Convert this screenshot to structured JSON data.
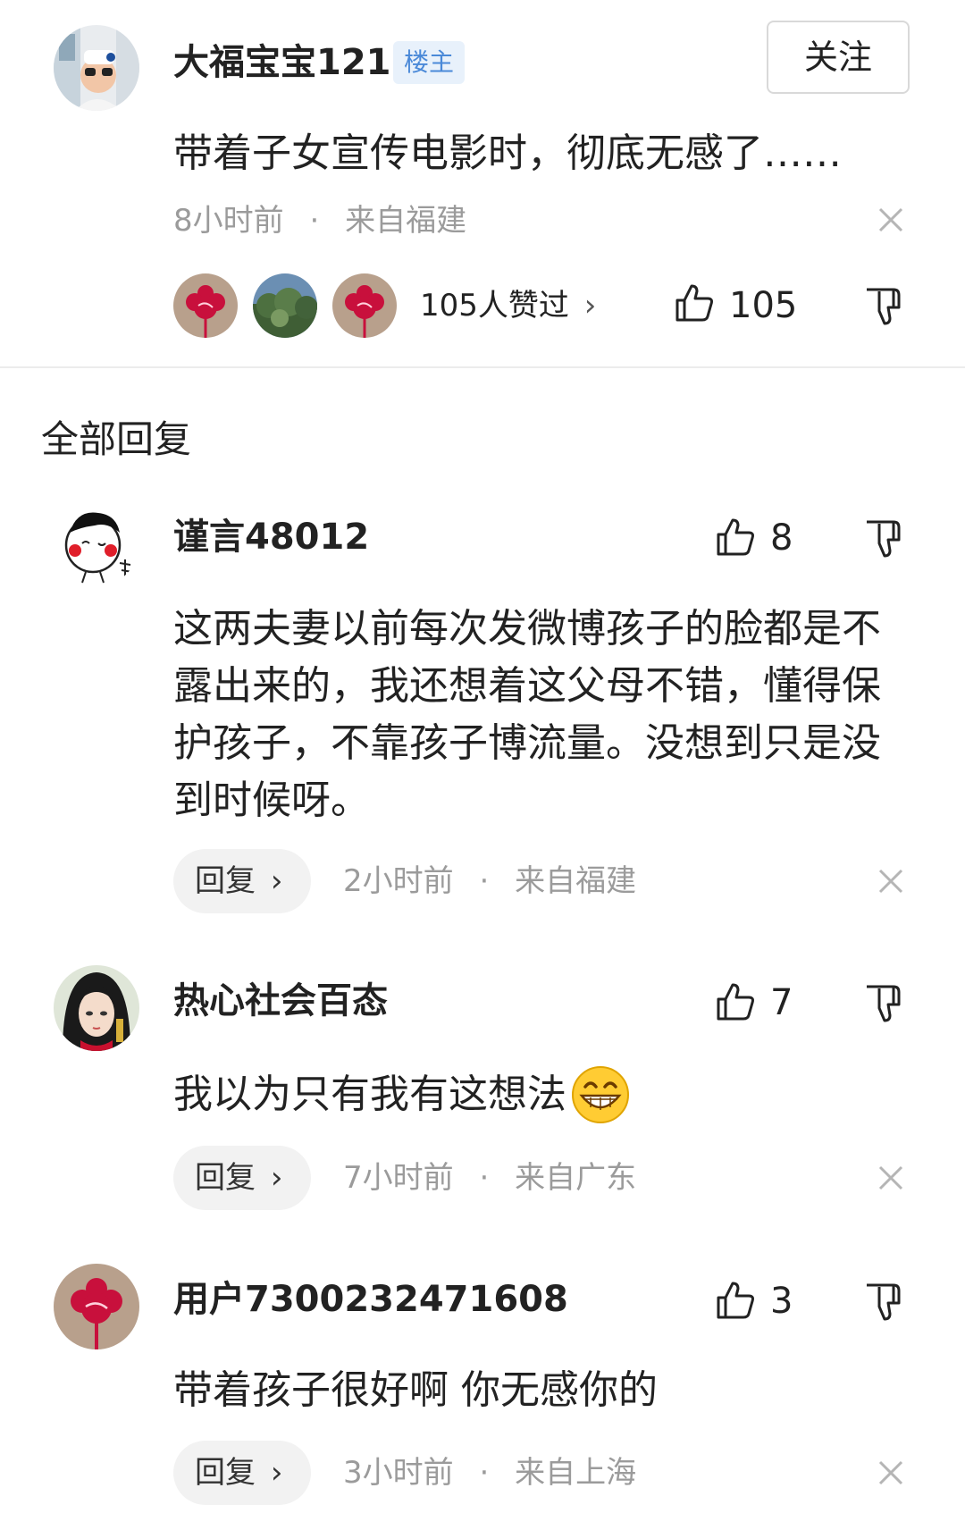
{
  "op": {
    "username": "大福宝宝121",
    "badge": "楼主",
    "follow_label": "关注",
    "text": "带着子女宣传电影时，彻底无感了……",
    "time": "8小时前",
    "dot": "·",
    "location": "来自福建",
    "likers_label": "105人赞过",
    "likers_chevron": "›",
    "like_count": "105"
  },
  "section_title": "全部回复",
  "replies": [
    {
      "username": "谨言48012",
      "like_count": "8",
      "text": "这两夫妻以前每次发微博孩子的脸都是不露出来的，我还想着这父母不错，懂得保护孩子，不靠孩子博流量。没想到只是没到时候呀。",
      "reply_label": "回复",
      "reply_chevron": "›",
      "time": "2小时前",
      "dot": "·",
      "location": "来自福建"
    },
    {
      "username": "热心社会百态",
      "like_count": "7",
      "text": "我以为只有我有这想法",
      "reply_label": "回复",
      "reply_chevron": "›",
      "time": "7小时前",
      "dot": "·",
      "location": "来自广东"
    },
    {
      "username": "用户7300232471608",
      "like_count": "3",
      "text": "带着孩子很好啊 你无感你的",
      "reply_label": "回复",
      "reply_chevron": "›",
      "time": "3小时前",
      "dot": "·",
      "location": "来自上海"
    }
  ],
  "icons": {
    "like": "thumbs-up-icon",
    "dislike": "thumbs-down-icon",
    "close": "close-icon",
    "emoji": "grinning-face-emoji"
  },
  "colors": {
    "badge_text": "#4a89d8",
    "badge_bg": "#e8f1fb",
    "meta_text": "#9b9b9b",
    "avatar_flower_bg": "#b8a08c",
    "avatar_flower": "#c8103c"
  }
}
